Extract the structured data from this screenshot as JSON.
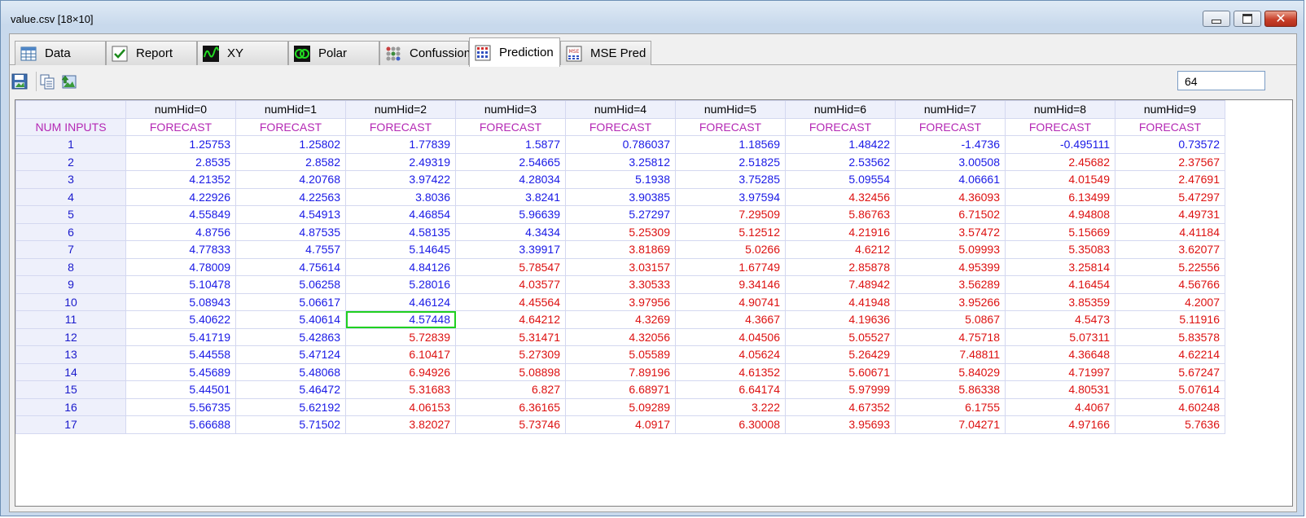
{
  "window": {
    "title": "value.csv [18×10]"
  },
  "tabs": [
    {
      "label": "Data",
      "icon": "data-table-icon"
    },
    {
      "label": "Report",
      "icon": "check-icon"
    },
    {
      "label": "XY",
      "icon": "xy-chart-icon"
    },
    {
      "label": "Polar",
      "icon": "polar-chart-icon"
    },
    {
      "label": "Confussion",
      "icon": "confusion-matrix-icon"
    },
    {
      "label": "Prediction",
      "icon": "prediction-grid-icon",
      "active": true
    },
    {
      "label": "MSE Pred",
      "icon": "mse-icon"
    }
  ],
  "toolbar": {
    "number_value": "64"
  },
  "grid": {
    "row_header_title": "NUM INPUTS",
    "sub_header": "FORECAST",
    "columns": [
      "numHid=0",
      "numHid=1",
      "numHid=2",
      "numHid=3",
      "numHid=4",
      "numHid=5",
      "numHid=6",
      "numHid=7",
      "numHid=8",
      "numHid=9"
    ],
    "colors": {
      "blue": "#1a1ae6",
      "red": "#dd1111",
      "selection": "#20d020"
    },
    "selected_cell": {
      "row": "11",
      "column": "numHid=2"
    },
    "rows": [
      {
        "label": "1",
        "values": [
          "1.25753",
          "1.25802",
          "1.77839",
          "1.5877",
          "0.786037",
          "1.18569",
          "1.48422",
          "-1.4736",
          "-0.495111",
          "0.73572"
        ],
        "colors": [
          "b",
          "b",
          "b",
          "b",
          "b",
          "b",
          "b",
          "b",
          "b",
          "b"
        ]
      },
      {
        "label": "2",
        "values": [
          "2.8535",
          "2.8582",
          "2.49319",
          "2.54665",
          "3.25812",
          "2.51825",
          "2.53562",
          "3.00508",
          "2.45682",
          "2.37567"
        ],
        "colors": [
          "b",
          "b",
          "b",
          "b",
          "b",
          "b",
          "b",
          "b",
          "r",
          "r"
        ]
      },
      {
        "label": "3",
        "values": [
          "4.21352",
          "4.20768",
          "3.97422",
          "4.28034",
          "5.1938",
          "3.75285",
          "5.09554",
          "4.06661",
          "4.01549",
          "2.47691"
        ],
        "colors": [
          "b",
          "b",
          "b",
          "b",
          "b",
          "b",
          "b",
          "b",
          "r",
          "r"
        ]
      },
      {
        "label": "4",
        "values": [
          "4.22926",
          "4.22563",
          "3.8036",
          "3.8241",
          "3.90385",
          "3.97594",
          "4.32456",
          "4.36093",
          "6.13499",
          "5.47297"
        ],
        "colors": [
          "b",
          "b",
          "b",
          "b",
          "b",
          "b",
          "r",
          "r",
          "r",
          "r"
        ]
      },
      {
        "label": "5",
        "values": [
          "4.55849",
          "4.54913",
          "4.46854",
          "5.96639",
          "5.27297",
          "7.29509",
          "5.86763",
          "6.71502",
          "4.94808",
          "4.49731"
        ],
        "colors": [
          "b",
          "b",
          "b",
          "b",
          "b",
          "r",
          "r",
          "r",
          "r",
          "r"
        ]
      },
      {
        "label": "6",
        "values": [
          "4.8756",
          "4.87535",
          "4.58135",
          "4.3434",
          "5.25309",
          "5.12512",
          "4.21916",
          "3.57472",
          "5.15669",
          "4.41184"
        ],
        "colors": [
          "b",
          "b",
          "b",
          "b",
          "r",
          "r",
          "r",
          "r",
          "r",
          "r"
        ]
      },
      {
        "label": "7",
        "values": [
          "4.77833",
          "4.7557",
          "5.14645",
          "3.39917",
          "3.81869",
          "5.0266",
          "4.6212",
          "5.09993",
          "5.35083",
          "3.62077"
        ],
        "colors": [
          "b",
          "b",
          "b",
          "b",
          "r",
          "r",
          "r",
          "r",
          "r",
          "r"
        ]
      },
      {
        "label": "8",
        "values": [
          "4.78009",
          "4.75614",
          "4.84126",
          "5.78547",
          "3.03157",
          "1.67749",
          "2.85878",
          "4.95399",
          "3.25814",
          "5.22556"
        ],
        "colors": [
          "b",
          "b",
          "b",
          "r",
          "r",
          "r",
          "r",
          "r",
          "r",
          "r"
        ]
      },
      {
        "label": "9",
        "values": [
          "5.10478",
          "5.06258",
          "5.28016",
          "4.03577",
          "3.30533",
          "9.34146",
          "7.48942",
          "3.56289",
          "4.16454",
          "4.56766"
        ],
        "colors": [
          "b",
          "b",
          "b",
          "r",
          "r",
          "r",
          "r",
          "r",
          "r",
          "r"
        ]
      },
      {
        "label": "10",
        "values": [
          "5.08943",
          "5.06617",
          "4.46124",
          "4.45564",
          "3.97956",
          "4.90741",
          "4.41948",
          "3.95266",
          "3.85359",
          "4.2007"
        ],
        "colors": [
          "b",
          "b",
          "b",
          "r",
          "r",
          "r",
          "r",
          "r",
          "r",
          "r"
        ]
      },
      {
        "label": "11",
        "values": [
          "5.40622",
          "5.40614",
          "4.57448",
          "4.64212",
          "4.3269",
          "4.3667",
          "4.19636",
          "5.0867",
          "4.5473",
          "5.11916"
        ],
        "colors": [
          "b",
          "b",
          "b",
          "r",
          "r",
          "r",
          "r",
          "r",
          "r",
          "r"
        ]
      },
      {
        "label": "12",
        "values": [
          "5.41719",
          "5.42863",
          "5.72839",
          "5.31471",
          "4.32056",
          "4.04506",
          "5.05527",
          "4.75718",
          "5.07311",
          "5.83578"
        ],
        "colors": [
          "b",
          "b",
          "r",
          "r",
          "r",
          "r",
          "r",
          "r",
          "r",
          "r"
        ]
      },
      {
        "label": "13",
        "values": [
          "5.44558",
          "5.47124",
          "6.10417",
          "5.27309",
          "5.05589",
          "4.05624",
          "5.26429",
          "7.48811",
          "4.36648",
          "4.62214"
        ],
        "colors": [
          "b",
          "b",
          "r",
          "r",
          "r",
          "r",
          "r",
          "r",
          "r",
          "r"
        ]
      },
      {
        "label": "14",
        "values": [
          "5.45689",
          "5.48068",
          "6.94926",
          "5.08898",
          "7.89196",
          "4.61352",
          "5.60671",
          "5.84029",
          "4.71997",
          "5.67247"
        ],
        "colors": [
          "b",
          "b",
          "r",
          "r",
          "r",
          "r",
          "r",
          "r",
          "r",
          "r"
        ]
      },
      {
        "label": "15",
        "values": [
          "5.44501",
          "5.46472",
          "5.31683",
          "6.827",
          "6.68971",
          "6.64174",
          "5.97999",
          "5.86338",
          "4.80531",
          "5.07614"
        ],
        "colors": [
          "b",
          "b",
          "r",
          "r",
          "r",
          "r",
          "r",
          "r",
          "r",
          "r"
        ]
      },
      {
        "label": "16",
        "values": [
          "5.56735",
          "5.62192",
          "4.06153",
          "6.36165",
          "5.09289",
          "3.222",
          "4.67352",
          "6.1755",
          "4.4067",
          "4.60248"
        ],
        "colors": [
          "b",
          "b",
          "r",
          "r",
          "r",
          "r",
          "r",
          "r",
          "r",
          "r"
        ]
      },
      {
        "label": "17",
        "values": [
          "5.66688",
          "5.71502",
          "3.82027",
          "5.73746",
          "4.0917",
          "6.30008",
          "3.95693",
          "7.04271",
          "4.97166",
          "5.7636"
        ],
        "colors": [
          "b",
          "b",
          "r",
          "r",
          "r",
          "r",
          "r",
          "r",
          "r",
          "r"
        ]
      }
    ]
  }
}
